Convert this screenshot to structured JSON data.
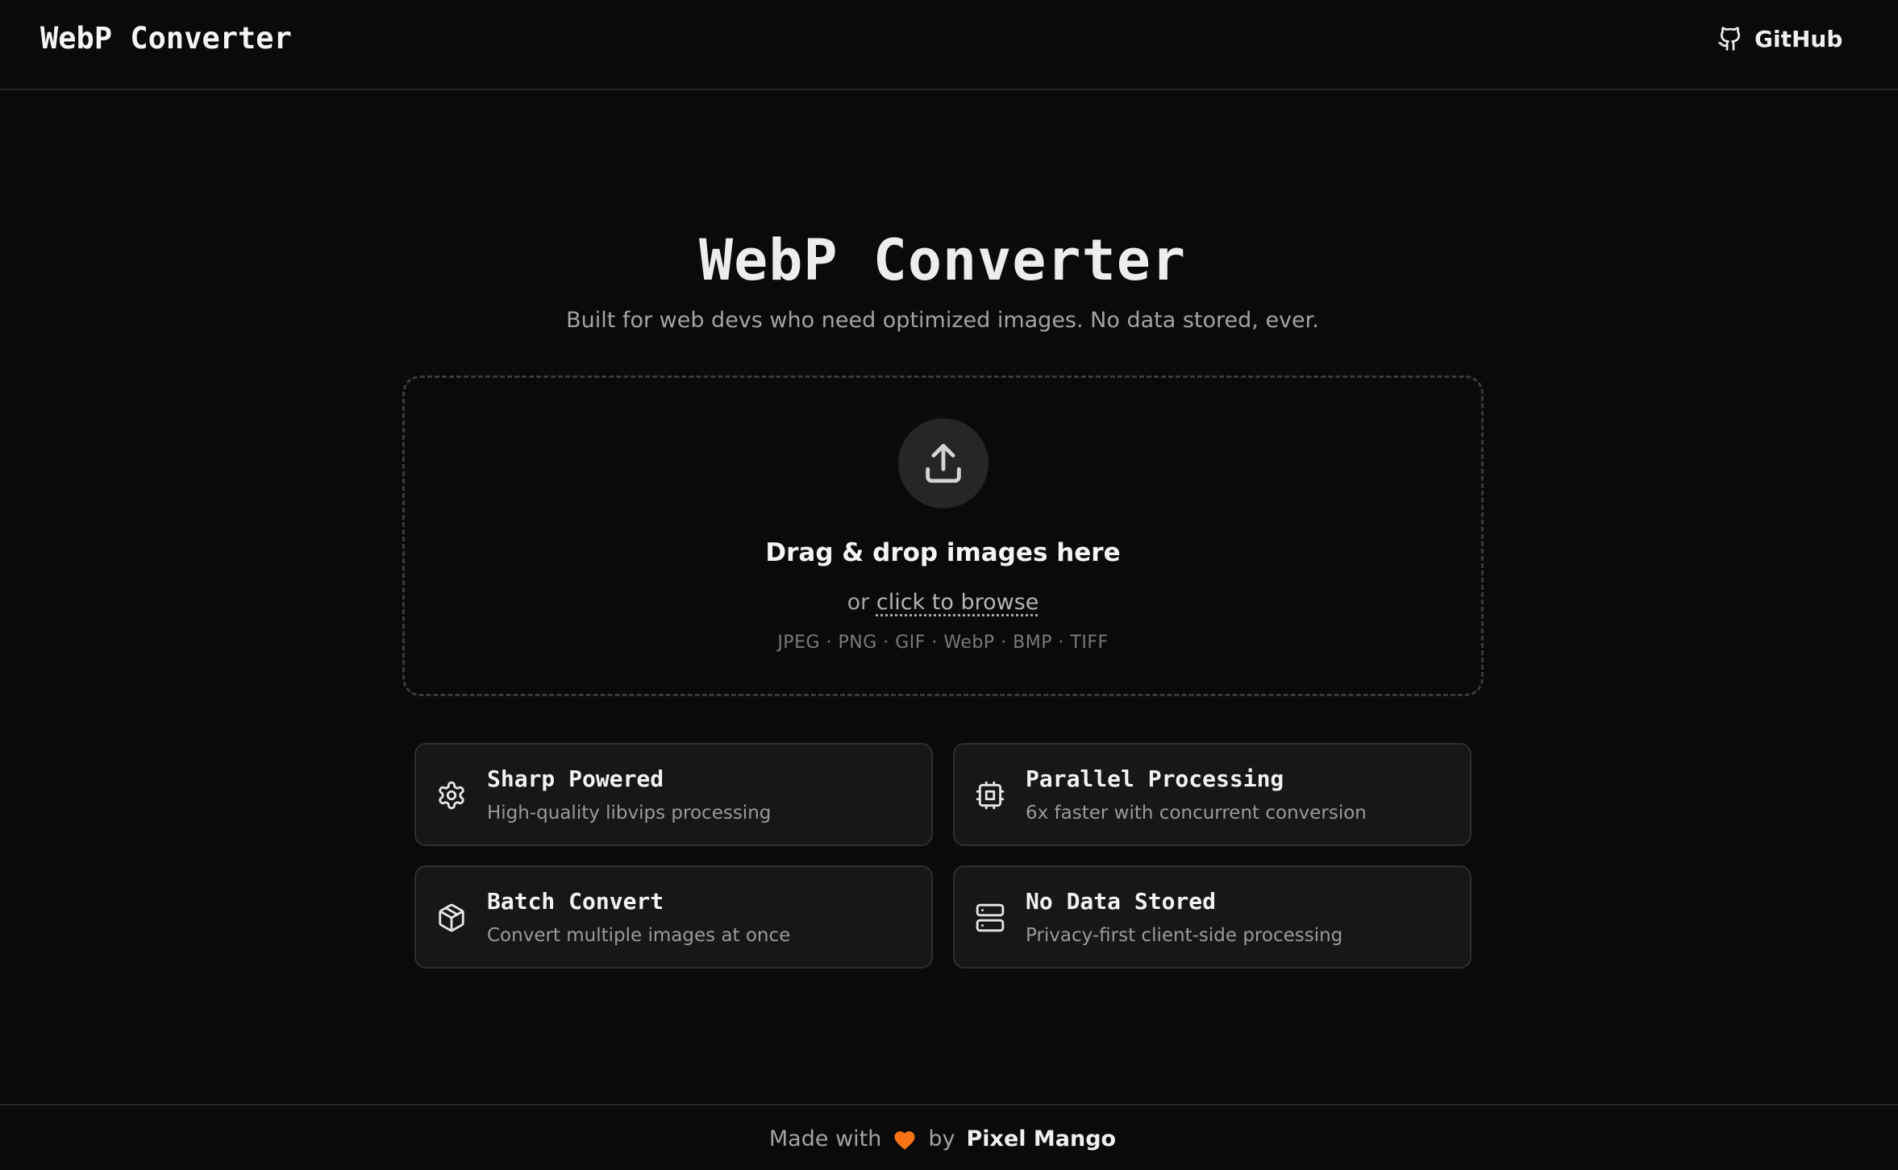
{
  "header": {
    "brand": "WebP Converter",
    "github_label": "GitHub",
    "github_icon": "github-icon"
  },
  "hero": {
    "title": "WebP Converter",
    "subtitle": "Built for web devs who need optimized images. No data stored, ever."
  },
  "dropzone": {
    "icon": "upload-icon",
    "title": "Drag & drop images here",
    "browse_prefix": "or",
    "browse_link": "click to browse",
    "formats": "JPEG · PNG · GIF · WebP · BMP · TIFF"
  },
  "features": [
    {
      "icon": "gear-icon",
      "title": "Sharp Powered",
      "description": "High-quality libvips processing"
    },
    {
      "icon": "cpu-icon",
      "title": "Parallel Processing",
      "description": "6x faster with concurrent conversion"
    },
    {
      "icon": "box-icon",
      "title": "Batch Convert",
      "description": "Convert multiple images at once"
    },
    {
      "icon": "server-icon",
      "title": "No Data Stored",
      "description": "Privacy-first client-side processing"
    }
  ],
  "footer": {
    "made_with": "Made with",
    "by": "by",
    "author": "Pixel Mango",
    "heart_icon": "heart-icon",
    "heart_color": "#f97316"
  },
  "colors": {
    "background": "#0a0a0a",
    "card_background": "#171717",
    "border": "#2e2e2e",
    "text_primary": "#ededed",
    "text_muted": "#a3a3a3"
  }
}
